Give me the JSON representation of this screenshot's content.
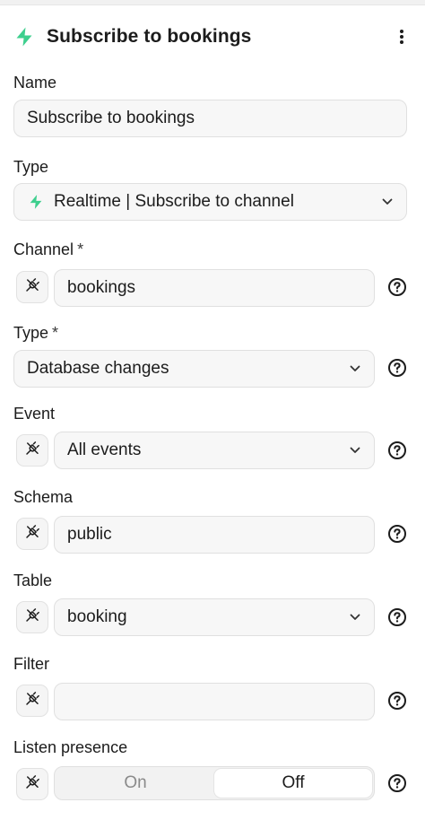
{
  "header": {
    "title": "Subscribe to bookings",
    "icon": "bolt-icon",
    "accent": "#3ecf8e"
  },
  "name": {
    "label": "Name",
    "value": "Subscribe to bookings"
  },
  "type": {
    "label": "Type",
    "value": "Realtime | Subscribe to channel"
  },
  "channel": {
    "label": "Channel",
    "required": "*",
    "value": "bookings"
  },
  "change_type": {
    "label": "Type",
    "required": "*",
    "value": "Database changes"
  },
  "event": {
    "label": "Event",
    "value": "All events"
  },
  "schema": {
    "label": "Schema",
    "value": "public"
  },
  "table": {
    "label": "Table",
    "value": "booking"
  },
  "filter": {
    "label": "Filter",
    "value": ""
  },
  "presence": {
    "label": "Listen presence",
    "on_label": "On",
    "off_label": "Off",
    "selected": "Off"
  }
}
